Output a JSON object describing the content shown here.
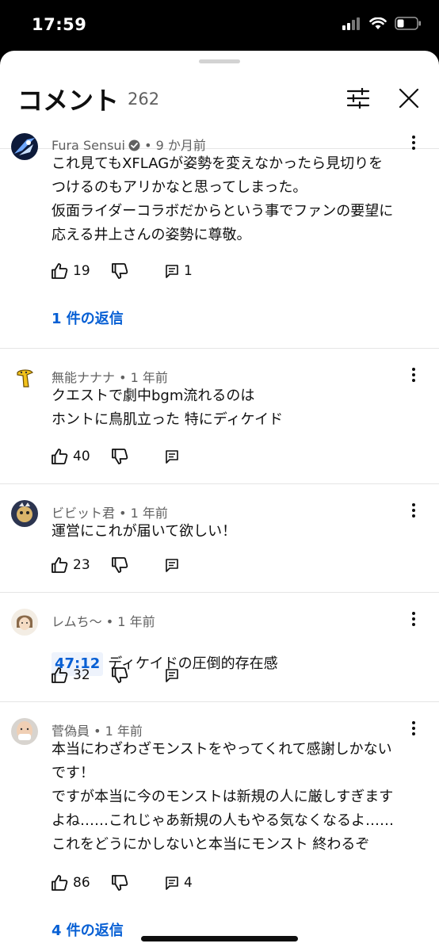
{
  "status_bar": {
    "time": "17:59"
  },
  "header": {
    "title": "コメント",
    "count": "262"
  },
  "comments": [
    {
      "author": "Fura Sensui",
      "verified": true,
      "time": "• 9 か月前",
      "text": "これ見てもXFLAGが姿勢を変えなかったら見切りを\nつけるのもアリかなと思ってしまった。\n仮面ライダーコラボだからという事でファンの要望に\n応える井上さんの姿勢に尊敬。",
      "likes": "19",
      "replies_count": "1",
      "replies_link": "1 件の返信"
    },
    {
      "author": "無能ナナナ",
      "time": "• 1 年前",
      "text": "クエストで劇中bgm流れるのは\nホントに鳥肌立った 特にディケイド",
      "likes": "40"
    },
    {
      "author": "ビビット君",
      "time": "• 1 年前",
      "text": "運営にこれが届いて欲しい！",
      "likes": "23"
    },
    {
      "author": "レムち〜",
      "time": "• 1 年前",
      "timestamp": "47:12",
      "text": "ディケイドの圧倒的存在感",
      "likes": "32"
    },
    {
      "author": "菅偽員",
      "time": "• 1 年前",
      "text": "本当にわざわざモンストをやってくれて感謝しかない\nです！\nですが本当に今のモンストは新規の人に厳しすぎます\nよね……これじゃあ新規の人もやる気なくなるよ……\nこれをどうにかしないと本当にモンスト 終わるぞ",
      "likes": "86",
      "replies_count": "4",
      "replies_link": "4 件の返信"
    }
  ],
  "colors": {
    "link": "#065fd4",
    "secondary": "#606060",
    "text": "#0f0f0f"
  },
  "icons": [
    "filter-icon",
    "close-icon",
    "like-icon",
    "dislike-icon",
    "reply-icon",
    "more-icon",
    "verified-icon"
  ]
}
